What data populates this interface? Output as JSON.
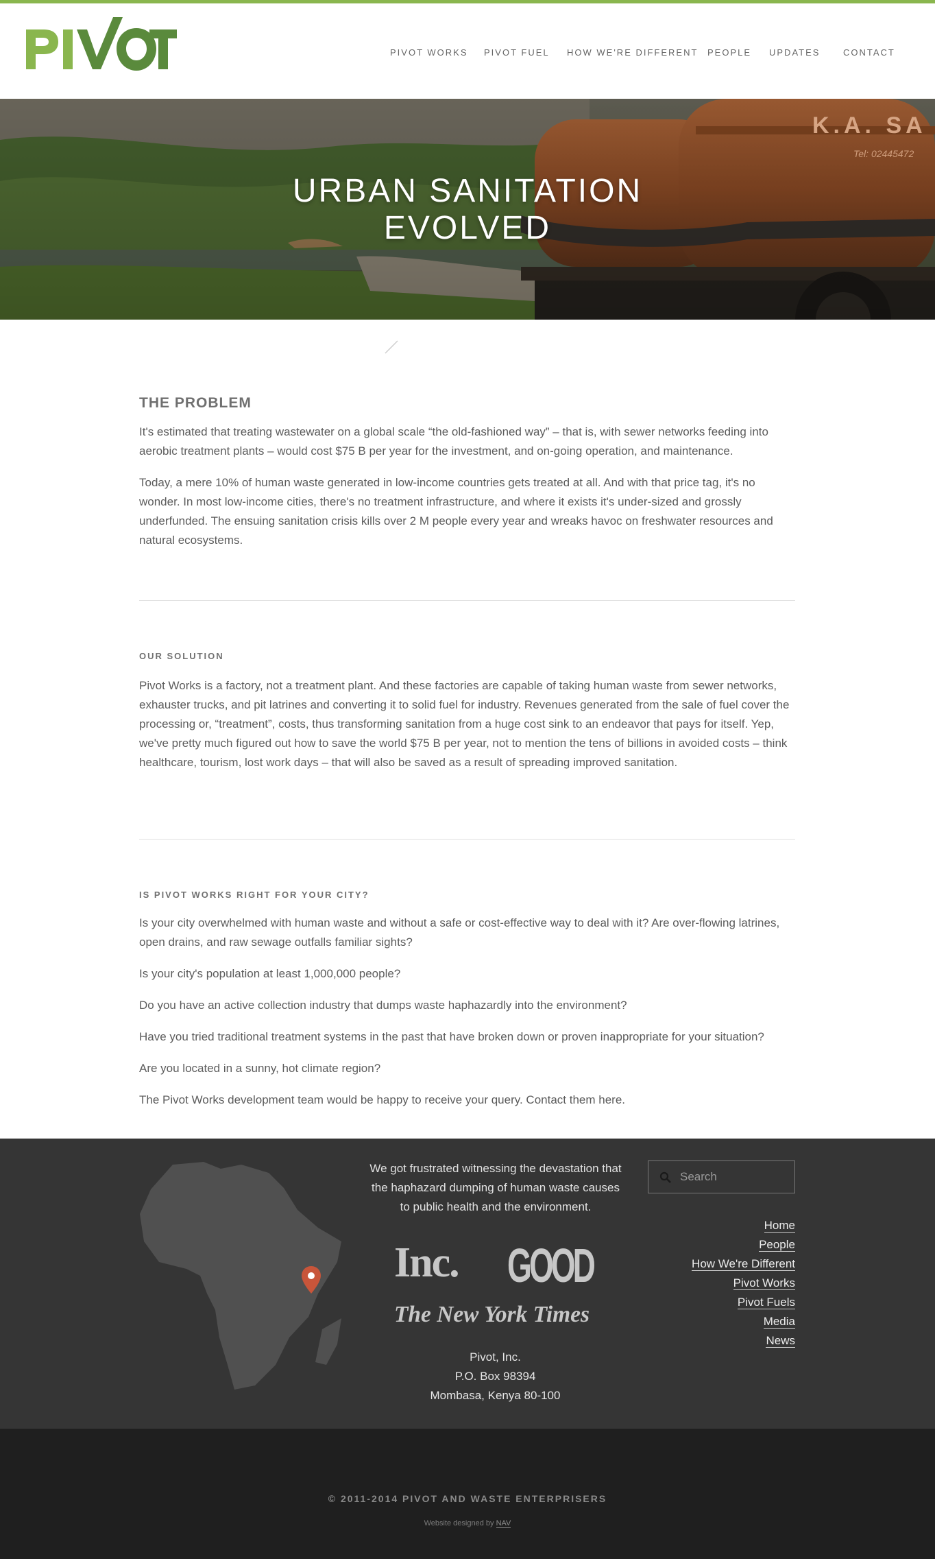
{
  "brand": {
    "logo_text": "PIVOT",
    "accent_light": "#8ab64e",
    "accent_dark": "#5a8a3c"
  },
  "nav": {
    "items": [
      {
        "label": "PIVOT WORKS"
      },
      {
        "label": "PIVOT FUEL"
      },
      {
        "label": "HOW WE'RE DIFFERENT"
      },
      {
        "label": "PEOPLE"
      },
      {
        "label": "UPDATES"
      },
      {
        "label": "CONTACT"
      }
    ]
  },
  "hero": {
    "title_line1": "URBAN SANITATION",
    "title_line2": "EVOLVED",
    "truck_text": "K.A. SA",
    "truck_tel": "Tel: 02445472"
  },
  "problem": {
    "heading": "THE PROBLEM",
    "p1": "It's estimated that treating wastewater on a global scale “the old-fashioned way” – that is, with sewer networks feeding into aerobic treatment plants – would cost $75 B per year for the investment, and on-going operation, and maintenance.",
    "p2": "Today, a mere 10% of human waste generated in low-income countries gets treated at all. And with that price tag, it's no wonder.  In most low-income cities, there's no treatment infrastructure, and where it exists it's under-sized and grossly underfunded.  The ensuing sanitation crisis kills over 2 M people every year and wreaks havoc on freshwater resources and natural ecosystems."
  },
  "solution": {
    "heading": "OUR SOLUTION",
    "p1": "Pivot Works is a factory, not a treatment plant.  And these factories are capable of taking human waste from sewer networks, exhauster trucks, and pit latrines and converting it to solid fuel for industry.  Revenues generated from the sale of fuel cover the processing or, “treatment”, costs, thus transforming sanitation from a huge cost sink to an endeavor that pays for itself.  Yep, we've pretty much figured out how to save the world $75 B per year, not to mention the tens of billions in avoided costs – think healthcare, tourism, lost work days – that will also be saved as a result of spreading improved sanitation."
  },
  "city": {
    "heading": "IS PIVOT WORKS RIGHT FOR YOUR CITY?",
    "q1": "Is your city overwhelmed with human waste and without a safe or cost-effective way to deal with it? Are over-flowing latrines, open drains, and raw sewage outfalls familiar sights?",
    "q2": "Is your city's population at least 1,000,000 people?",
    "q3": "Do you have an active collection industry that dumps waste haphazardly into the environment?",
    "q4": "Have you tried traditional treatment systems in the past that have broken down or proven inappropriate for your situation?",
    "q5": "Are you located in a sunny, hot climate region?",
    "cta": "The Pivot Works development team would be happy to receive your query.  Contact them here."
  },
  "footer": {
    "quote": "We got frustrated witnessing the devastation that the haphazard dumping of human waste causes to public health and the environment.",
    "press": {
      "inc": "Inc.",
      "good": "GOOD",
      "nyt": "The New York Times"
    },
    "address": {
      "line1": "Pivot, Inc.",
      "line2": "P.O. Box 98394",
      "line3": "Mombasa, Kenya 80-100"
    },
    "search_placeholder": "Search",
    "links": [
      {
        "label": "Home"
      },
      {
        "label": "People"
      },
      {
        "label": "How We're Different"
      },
      {
        "label": "Pivot Works"
      },
      {
        "label": "Pivot Fuels"
      },
      {
        "label": "Media"
      },
      {
        "label": "News"
      }
    ],
    "map_pin_color": "#c8553a"
  },
  "bottom": {
    "copyright": "© 2011-2014 PIVOT AND WASTE ENTERPRISERS",
    "designed_prefix": "Website designed by",
    "designed_link": "NAV"
  }
}
